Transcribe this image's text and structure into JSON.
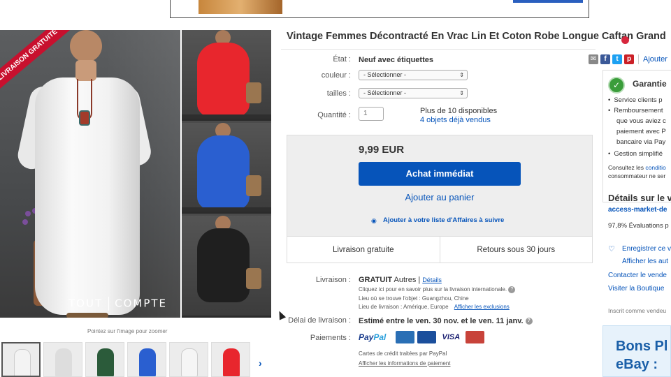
{
  "title": "Vintage Femmes Décontracté En Vrac Lin Et Coton Robe Longue Caftan Grand",
  "ribbon": "LIVRAISON GRATUITE",
  "watermark": {
    "left": "TOUT",
    "right": "COMPTE"
  },
  "zoom_hint": "Pointez sur l'image pour zoomer",
  "share": {
    "add_link": "Ajouter",
    "icons": [
      "email-icon",
      "facebook-icon",
      "twitter-icon",
      "pinterest-icon"
    ]
  },
  "fields": {
    "etat": {
      "label": "État :",
      "value": "Neuf avec étiquettes"
    },
    "couleur": {
      "label": "couleur :",
      "value": "- Sélectionner -"
    },
    "tailles": {
      "label": "tailles :",
      "value": "- Sélectionner -"
    },
    "quantite": {
      "label": "Quantité :",
      "value": "1",
      "available": "Plus de 10 disponibles",
      "sold": "4 objets déjà vendus"
    }
  },
  "price": "9,99 EUR",
  "buy_button": "Achat immédiat",
  "cart_link": "Ajouter au panier",
  "watch_link": "Ajouter à votre liste d'Affaires à suivre",
  "shipping_bar": {
    "left": "Livraison gratuite",
    "right": "Retours sous 30 jours"
  },
  "livraison": {
    "label": "Livraison :",
    "value": "GRATUIT",
    "others": "Autres |",
    "details": "Détails",
    "intl": "Cliquez ici pour en savoir plus sur la livraison internationale.",
    "location": "Lieu où se trouve l'objet : Guangzhou, Chine",
    "ship_to": "Lieu de livraison : Amérique, Europe",
    "exclusions": "Afficher les exclusions"
  },
  "delai": {
    "label": "Délai de livraison :",
    "value": "Estimé entre le ven. 30 nov. et le ven. 11 janv."
  },
  "paiements": {
    "label": "Paiements :",
    "paypal_a": "Pay",
    "paypal_b": "Pal",
    "cards_note": "Cartes de crédit traitées par PayPal",
    "details_link": "Afficher les informations de paiement",
    "card_labels": [
      "AMEX",
      "Maestro",
      "VISA",
      "MC"
    ]
  },
  "sidebar": {
    "garantie": "Garantie",
    "bullets": [
      "Service clients p",
      "Remboursement",
      "que vous aviez c",
      "paiement avec P",
      "bancaire via Pay",
      "Gestion simplifié"
    ],
    "consultez_a": "Consultez les",
    "consultez_b": "conditio",
    "consommateur": "consommateur ne ser",
    "seller_title": "Détails sur le v",
    "seller_name": "access-market-de",
    "evaluations": "97,8% Évaluations p",
    "register": "Enregistrer ce v",
    "show_other": "Afficher les aut",
    "contact": "Contacter le vende",
    "visit": "Visiter la Boutique",
    "since": "Inscrit comme vendeu",
    "bons_a": "Bons Pl",
    "bons_b": "eBay :"
  },
  "colors": {
    "accent": "#0654ba",
    "ribbon": "#c8102e",
    "variants": [
      "#e8262d",
      "#2a5fd0",
      "#1f1f1f"
    ]
  }
}
